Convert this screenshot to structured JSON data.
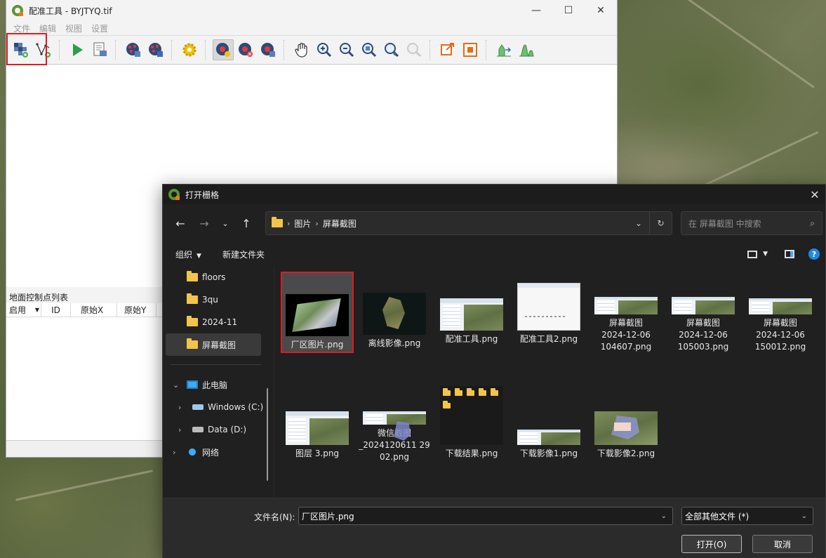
{
  "georeferencer": {
    "title": "配准工具 - BYJTYQ.tif",
    "menu": [
      "文件",
      "编辑",
      "视图",
      "设置"
    ],
    "window_controls": {
      "minimize": "—",
      "maximize": "☐",
      "close": "✕"
    },
    "gcp_panel": {
      "title": "地面控制点列表",
      "columns": [
        "启用",
        "ID",
        "原始X",
        "原始Y"
      ]
    }
  },
  "dialog": {
    "title": "打开栅格",
    "close": "✕",
    "breadcrumb": [
      "图片",
      "屏幕截图"
    ],
    "search_placeholder": "在 屏幕截图 中搜索",
    "commands": {
      "organize": "组织",
      "new_folder": "新建文件夹"
    },
    "nav": {
      "folders": [
        "floors",
        "3qu",
        "2024-11",
        "屏幕截图"
      ],
      "this_pc": "此电脑",
      "drives": [
        "Windows (C:)",
        "Data (D:)"
      ],
      "network": "网络"
    },
    "files": [
      {
        "name": "厂区图片.png",
        "selected": true
      },
      {
        "name": "离线影像.png"
      },
      {
        "name": "配准工具.png"
      },
      {
        "name": "配准工具2.png"
      },
      {
        "name": "屏幕截图 2024-12-06 104607.png"
      },
      {
        "name": "屏幕截图 2024-12-06 105003.png"
      },
      {
        "name": "屏幕截图 2024-12-06 150012.png"
      },
      {
        "name": "图层 3.png"
      },
      {
        "name": "微信截图_20241206112902.png"
      },
      {
        "name": "下载结果.png"
      },
      {
        "name": "下载影像1.png"
      },
      {
        "name": "下载影像2.png"
      }
    ],
    "file_labels": [
      "厂区图片.png",
      "离线影像.png",
      "配准工具.png",
      "配准工具2.png",
      [
        "屏幕截图",
        "2024-12-06",
        "104607.png"
      ],
      [
        "屏幕截图",
        "2024-12-06",
        "105003.png"
      ],
      [
        "屏幕截图",
        "2024-12-06",
        "150012.png"
      ],
      "图层 3.png",
      [
        "微信截图",
        "_2024120611 29",
        "02.png"
      ],
      "下载结果.png",
      "下载影像1.png",
      "下载影像2.png"
    ],
    "filename_label": "文件名(N):",
    "filename_value": "厂区图片.png",
    "filetype_value": "全部其他文件 (*)",
    "open_button": "打开(O)",
    "cancel_button": "取消"
  },
  "colors": {
    "highlight": "#e01b24",
    "dialog_bg": "#202020",
    "qgis_green": "#589632"
  }
}
